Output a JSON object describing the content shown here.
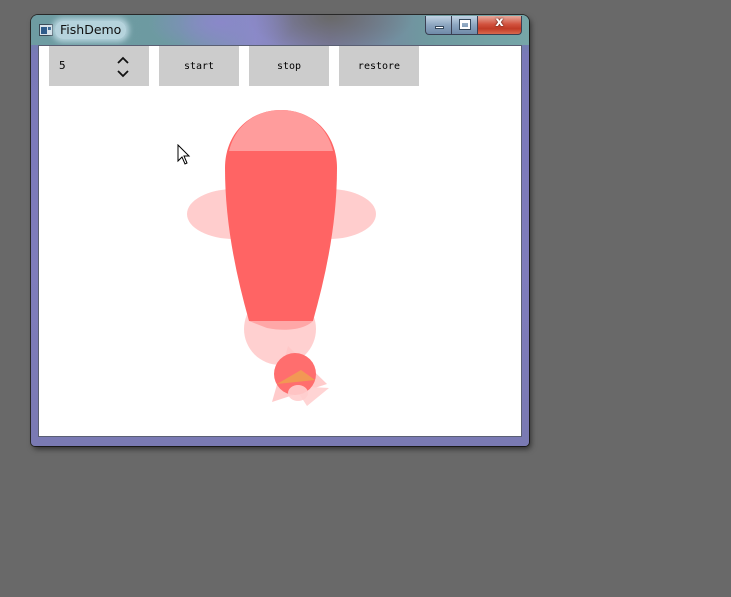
{
  "window": {
    "title": "FishDemo",
    "icon": "app-window-icon",
    "close_label": "x"
  },
  "toolbar": {
    "spin_value": "5",
    "start_label": "start",
    "stop_label": "stop",
    "restore_label": "restore"
  },
  "colors": {
    "desktop": "#696969",
    "fish_body": "#ff6464",
    "fish_light": "#ff9c9c",
    "fins": "#ffc8c8",
    "button_bg": "#cccccc",
    "tail_dot": "#f0a050"
  },
  "icons": [
    "app-window-icon",
    "minimize-icon",
    "maximize-icon",
    "close-icon",
    "spin-up-icon",
    "spin-down-icon",
    "mouse-cursor-icon"
  ]
}
